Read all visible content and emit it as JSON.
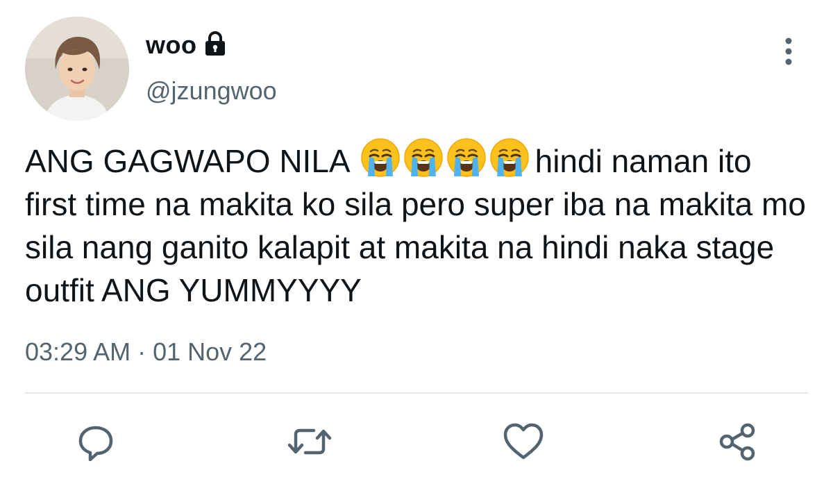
{
  "author": {
    "display_name": "woo",
    "handle": "@jzungwoo",
    "protected": true
  },
  "tweet": {
    "text_before_emoji": "ANG GAGWAPO NILA",
    "emoji": [
      "crying-face-emoji",
      "crying-face-emoji",
      "crying-face-emoji",
      "crying-face-emoji"
    ],
    "text_after_emoji": "hindi naman ito first time na makita ko sila pero super iba na makita mo sila nang ganito kalapit at makita na hindi naka stage outfit ANG YUMMYYYY",
    "timestamp": "03:29 AM · 01 Nov 22"
  },
  "actions": [
    "reply-icon",
    "retweet-icon",
    "like-icon",
    "share-icon"
  ],
  "colors": {
    "text_primary": "#0f1419",
    "text_secondary": "#536471",
    "icon": "#536471",
    "divider": "#e6e9ec"
  }
}
